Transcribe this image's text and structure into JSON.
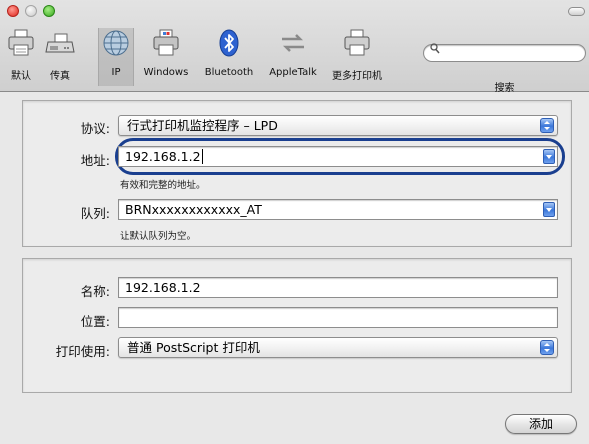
{
  "toolbar": {
    "tabs": [
      {
        "label": "默认",
        "icon": "printer-icon"
      },
      {
        "label": "传真",
        "icon": "fax-icon"
      },
      {
        "label": "IP",
        "icon": "globe-icon"
      },
      {
        "label": "Windows",
        "icon": "windows-printer-icon"
      },
      {
        "label": "Bluetooth",
        "icon": "bluetooth-icon"
      },
      {
        "label": "AppleTalk",
        "icon": "appletalk-icon"
      },
      {
        "label": "更多打印机",
        "icon": "more-printers-icon"
      }
    ],
    "selected_tab": "IP",
    "search": {
      "label": "搜索",
      "value": "",
      "icon": "search-icon"
    }
  },
  "form": {
    "protocol": {
      "label": "协议:",
      "value": "行式打印机监控程序 – LPD"
    },
    "address": {
      "label": "地址:",
      "value": "192.168.1.2",
      "hint": "有效和完整的地址。"
    },
    "queue": {
      "label": "队列:",
      "value": "BRNxxxxxxxxxxxx_AT",
      "hint": "让默认队列为空。"
    },
    "name": {
      "label": "名称:",
      "value": "192.168.1.2"
    },
    "location": {
      "label": "位置:",
      "value": ""
    },
    "print_using": {
      "label": "打印使用:",
      "value": "普通 PostScript 打印机"
    }
  },
  "actions": {
    "add_label": "添加"
  },
  "colors": {
    "focus_ring": "#1a3f8f",
    "stepper_blue": "#3b77da"
  }
}
